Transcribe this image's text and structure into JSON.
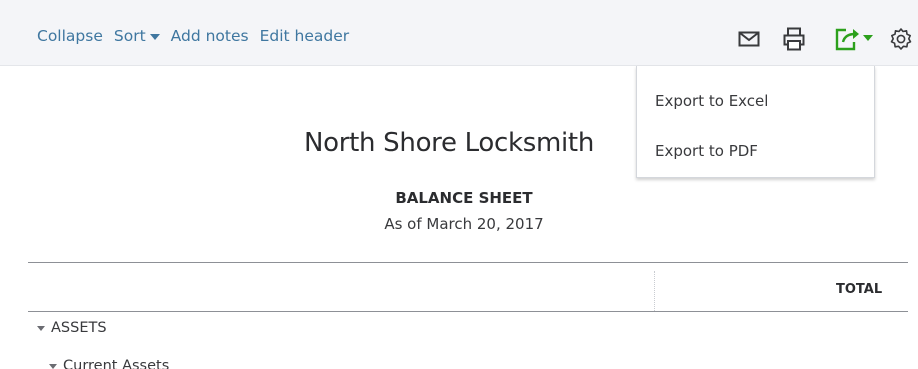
{
  "toolbar": {
    "collapse_label": "Collapse",
    "sort_label": "Sort",
    "add_notes_label": "Add notes",
    "edit_header_label": "Edit header",
    "icons": [
      "mail-icon",
      "print-icon",
      "export-icon",
      "settings-icon"
    ],
    "link_color": "#3f77a0",
    "export_icon_color": "#2ca01c",
    "background": "#f4f5f8"
  },
  "export_menu": {
    "items": [
      {
        "label": "Export to Excel"
      },
      {
        "label": "Export to PDF"
      }
    ]
  },
  "report": {
    "company": "North Shore Locksmith",
    "title": "BALANCE SHEET",
    "date": "As of March 20, 2017"
  },
  "table": {
    "columns": [
      "TOTAL"
    ],
    "rows": [
      {
        "label": "ASSETS",
        "level": 0
      },
      {
        "label": "Current Assets",
        "level": 1
      }
    ]
  }
}
